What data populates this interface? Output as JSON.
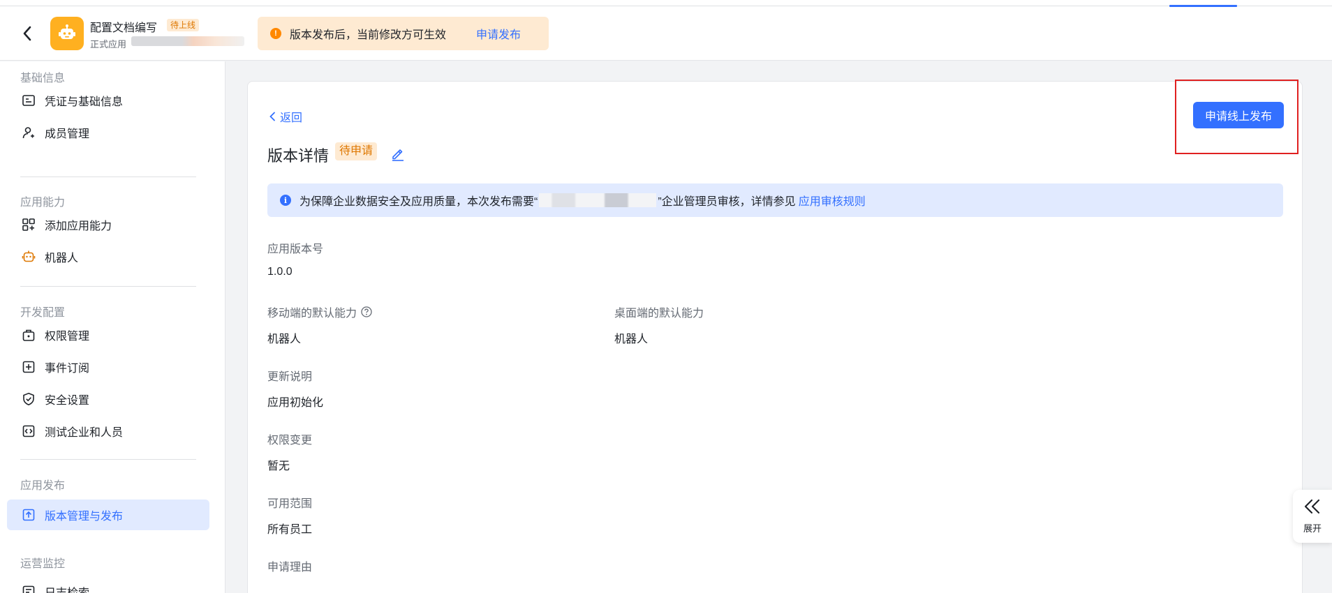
{
  "header": {
    "app_name": "配置文档编写",
    "status_tag": "待上线",
    "app_type": "正式应用",
    "notice_text": "版本发布后，当前修改方可生效",
    "notice_link": "申请发布"
  },
  "sidebar": {
    "groups": [
      {
        "title": "基础信息",
        "items": [
          {
            "label": "凭证与基础信息",
            "icon": "credential-icon"
          },
          {
            "label": "成员管理",
            "icon": "member-add-icon"
          }
        ]
      },
      {
        "title": "应用能力",
        "items": [
          {
            "label": "添加应用能力",
            "icon": "apps-add-icon"
          },
          {
            "label": "机器人",
            "icon": "robot-icon"
          }
        ]
      },
      {
        "title": "开发配置",
        "items": [
          {
            "label": "权限管理",
            "icon": "permission-icon"
          },
          {
            "label": "事件订阅",
            "icon": "event-icon"
          },
          {
            "label": "安全设置",
            "icon": "shield-icon"
          },
          {
            "label": "测试企业和人员",
            "icon": "code-icon"
          }
        ]
      },
      {
        "title": "应用发布",
        "items": [
          {
            "label": "版本管理与发布",
            "icon": "upload-icon",
            "active": true
          }
        ]
      },
      {
        "title": "运营监控",
        "items": [
          {
            "label": "日志检索",
            "icon": "log-icon"
          }
        ]
      }
    ]
  },
  "detail": {
    "back_label": "返回",
    "title": "版本详情",
    "status": "待申请",
    "publish_button": "申请线上发布",
    "banner": {
      "text_before": "为保障企业数据安全及应用质量，本次发布需要“",
      "text_after": "”企业管理员审核，详情参见",
      "link": "应用审核规则"
    },
    "fields": {
      "version_label": "应用版本号",
      "version_value": "1.0.0",
      "mobile_default_label": "移动端的默认能力",
      "mobile_default_value": "机器人",
      "desktop_default_label": "桌面端的默认能力",
      "desktop_default_value": "机器人",
      "changelog_label": "更新说明",
      "changelog_value": "应用初始化",
      "permission_change_label": "权限变更",
      "permission_change_value": "暂无",
      "scope_label": "可用范围",
      "scope_value": "所有员工",
      "reason_label": "申请理由"
    }
  },
  "expand_label": "展开",
  "colors": {
    "primary": "#3370ff",
    "warning": "#ff8800",
    "tag_orange": "#de7802",
    "highlight_frame": "#e02020"
  }
}
